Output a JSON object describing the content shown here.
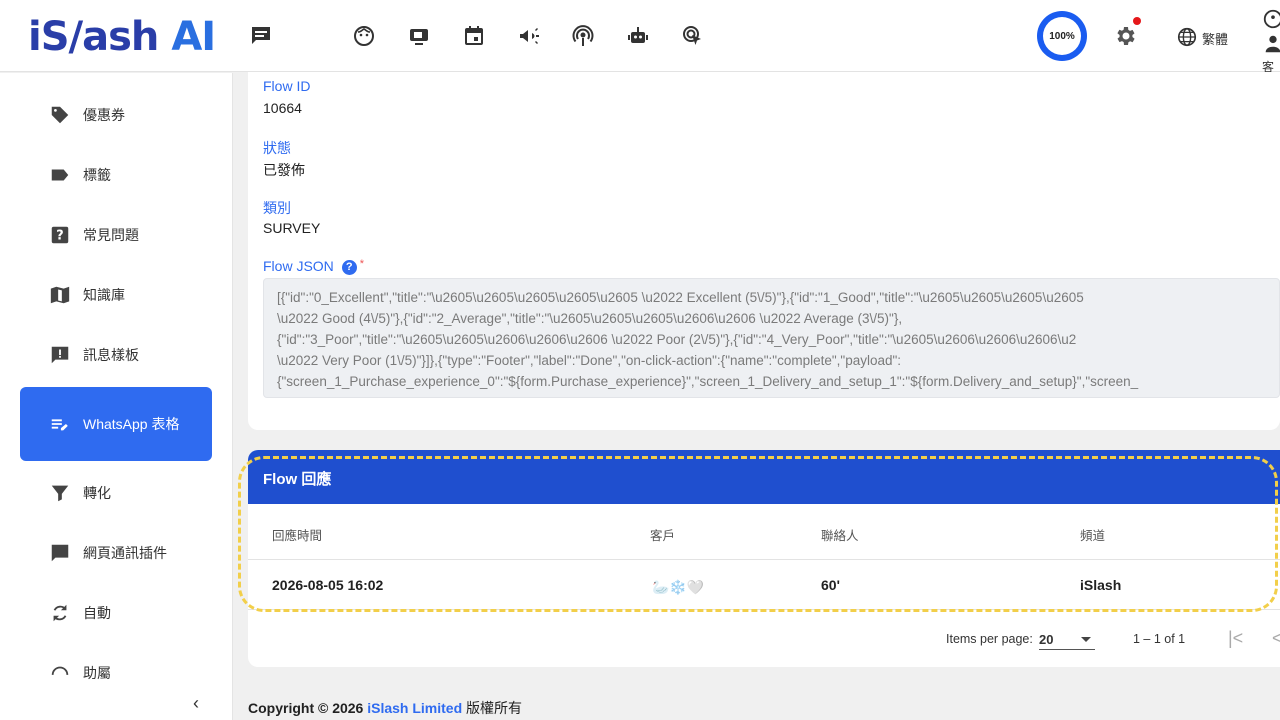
{
  "header": {
    "logo_main": "iS/ash",
    "logo_ai": "AI",
    "gauge": "100%",
    "lang_label": "繁體",
    "user_label": "客"
  },
  "topnav": [
    {
      "icon": "chat-icon"
    },
    {
      "icon": "face-icon"
    },
    {
      "icon": "broadcast-video-icon"
    },
    {
      "icon": "calendar-icon"
    },
    {
      "icon": "megaphone-icon"
    },
    {
      "icon": "podcast-icon"
    },
    {
      "icon": "robot-icon"
    },
    {
      "icon": "cursor-click-icon"
    }
  ],
  "sidebar": {
    "items": [
      {
        "label": "優惠券",
        "icon": "tag-icon"
      },
      {
        "label": "標籤",
        "icon": "label-icon"
      },
      {
        "label": "常見問題",
        "icon": "help-icon"
      },
      {
        "label": "知識庫",
        "icon": "book-icon"
      },
      {
        "label": "訊息樣板",
        "icon": "alert-message-icon"
      },
      {
        "label": "WhatsApp 表格",
        "icon": "edit-list-icon",
        "active": true
      },
      {
        "label": "轉化",
        "icon": "filter-icon"
      },
      {
        "label": "網頁通訊插件",
        "icon": "chat-bubble-icon"
      },
      {
        "label": "自動",
        "icon": "refresh-icon"
      },
      {
        "label": "助屬",
        "icon": "headset-icon"
      }
    ],
    "collapse": "‹"
  },
  "details": {
    "flow_id_label": "Flow ID",
    "flow_id_value": "10664",
    "status_label": "狀態",
    "status_value": "已發佈",
    "category_label": "類別",
    "category_value": "SURVEY",
    "json_label": "Flow JSON",
    "json_required": "*",
    "json_text": "[{\"id\":\"0_Excellent\",\"title\":\"\\u2605\\u2605\\u2605\\u2605\\u2605 \\u2022 Excellent (5\\/5)\"},{\"id\":\"1_Good\",\"title\":\"\\u2605\\u2605\\u2605\\u2605\n\\u2022 Good (4\\/5)\"},{\"id\":\"2_Average\",\"title\":\"\\u2605\\u2605\\u2605\\u2606\\u2606 \\u2022 Average (3\\/5)\"},\n{\"id\":\"3_Poor\",\"title\":\"\\u2605\\u2605\\u2606\\u2606\\u2606 \\u2022 Poor (2\\/5)\"},{\"id\":\"4_Very_Poor\",\"title\":\"\\u2605\\u2606\\u2606\\u2606\\u2\n\\u2022 Very Poor (1\\/5)\"}]},{\"type\":\"Footer\",\"label\":\"Done\",\"on-click-action\":{\"name\":\"complete\",\"payload\":\n{\"screen_1_Purchase_experience_0\":\"${form.Purchase_experience}\",\"screen_1_Delivery_and_setup_1\":\"${form.Delivery_and_setup}\",\"screen_"
  },
  "flow_responses": {
    "title": "Flow 回應",
    "columns": [
      "回應時間",
      "客戶",
      "聯絡人",
      "頻道"
    ],
    "rows": [
      {
        "time": "2026-08-05 16:02",
        "customer": "🦢❄️🤍",
        "contact": "60'",
        "channel": "iSlash"
      }
    ],
    "paginator": {
      "items_per_page_label": "Items per page:",
      "items_per_page": "20",
      "range": "1 – 1 of 1",
      "first": "|<",
      "prev": "<"
    }
  },
  "footer": {
    "copyright": "Copyright © 2026",
    "brand": "iSlash Limited",
    "rights": "版權所有"
  }
}
